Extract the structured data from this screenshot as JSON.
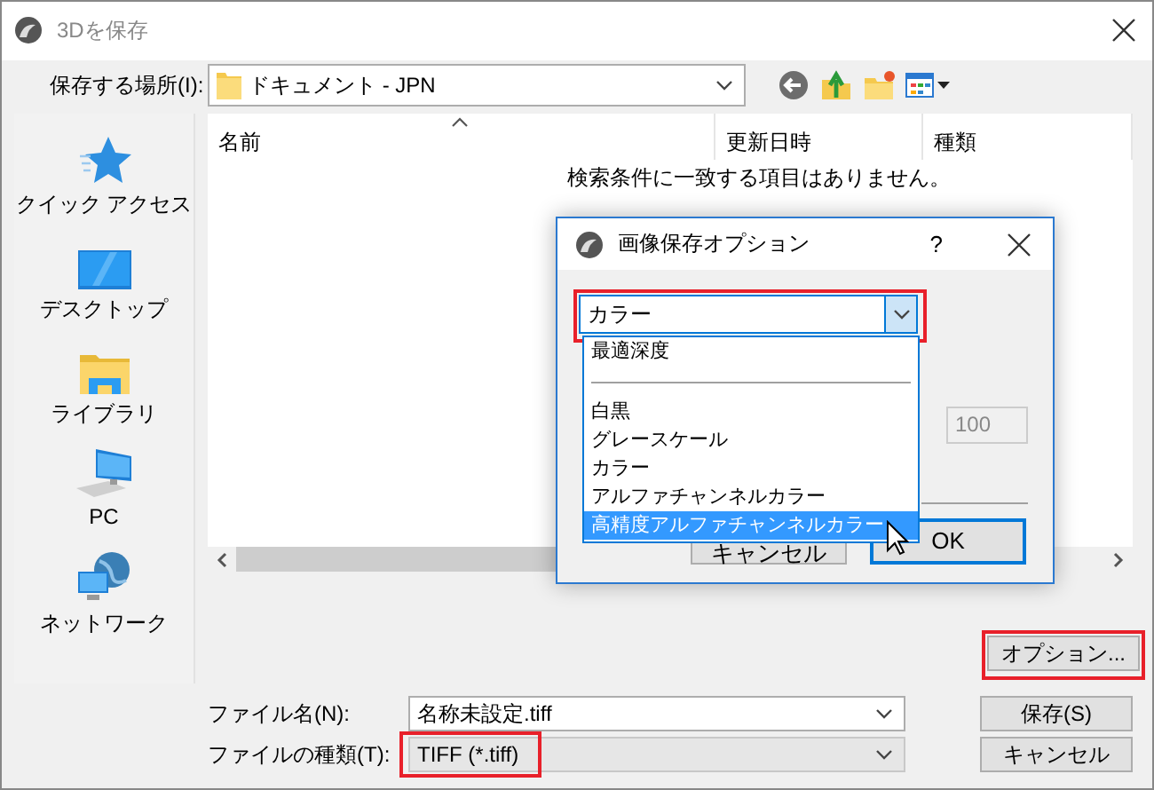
{
  "window": {
    "title": "3Dを保存"
  },
  "location": {
    "label": "保存する場所(I):",
    "value": "ドキュメント - JPN"
  },
  "places": [
    {
      "kind": "star",
      "label": "クイック アクセス"
    },
    {
      "kind": "desktop",
      "label": "デスクトップ"
    },
    {
      "kind": "library",
      "label": "ライブラリ"
    },
    {
      "kind": "pc",
      "label": "PC"
    },
    {
      "kind": "network",
      "label": "ネットワーク"
    }
  ],
  "file_list": {
    "columns": [
      "名前",
      "更新日時",
      "種類"
    ],
    "empty_message": "検索条件に一致する項目はありません。"
  },
  "options_button": {
    "label": "オプション...",
    "highlighted": true
  },
  "file_name": {
    "label": "ファイル名(N):",
    "value": "名称未設定.tiff"
  },
  "file_type": {
    "label": "ファイルの種類(T):",
    "value": "TIFF (*.tiff)",
    "highlighted": true
  },
  "buttons": [
    "保存(S)",
    "キャンセル"
  ],
  "options_dialog": {
    "title": "画像保存オプション",
    "help": "?",
    "color_mode": {
      "value": "カラー",
      "highlighted": true
    },
    "dropdown": [
      {
        "kind": "item",
        "label": "最適深度",
        "selected": false
      },
      {
        "kind": "separator"
      },
      {
        "kind": "item",
        "label": "白黒",
        "selected": false
      },
      {
        "kind": "item",
        "label": "グレースケール",
        "selected": false
      },
      {
        "kind": "item",
        "label": "カラー",
        "selected": false
      },
      {
        "kind": "item",
        "label": "アルファチャンネルカラー",
        "selected": false
      },
      {
        "kind": "item",
        "label": "高精度アルファチャンネルカラー",
        "selected": true
      }
    ],
    "quality": {
      "value": "100",
      "disabled": true
    },
    "buttons": [
      {
        "label": "キャンセル",
        "default": false
      },
      {
        "label": "OK",
        "default": true
      }
    ]
  }
}
